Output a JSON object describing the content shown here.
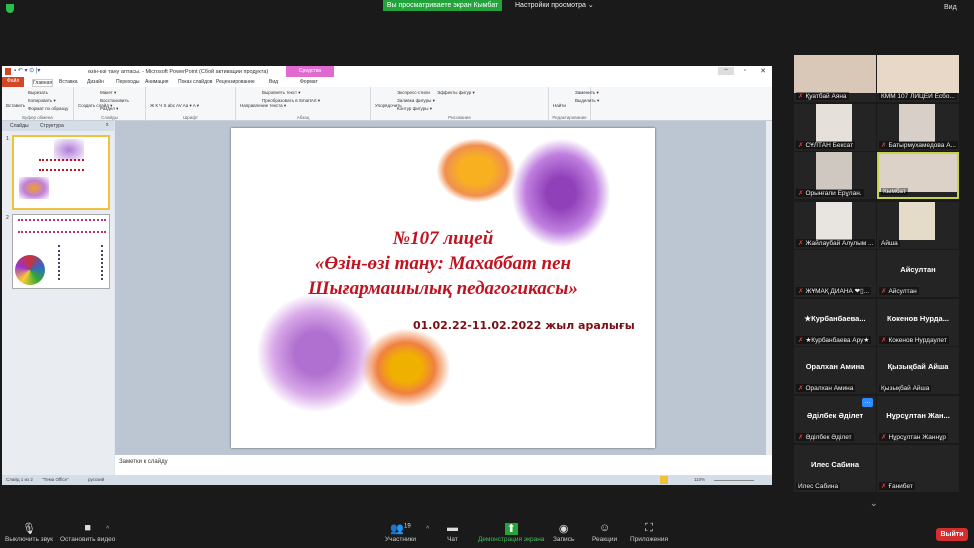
{
  "zoom": {
    "banner": "Вы просматриваете экран Кымбат",
    "view_options": "Настройки просмотра ⌄",
    "view": "Вид",
    "leave": "Выйти",
    "toolbar": [
      {
        "icon": "microphone-icon",
        "label": "Выключить звук"
      },
      {
        "icon": "video-camera-icon",
        "label": "Остановить видео"
      },
      {
        "icon": "participants-icon",
        "label": "Участники",
        "count": "19"
      },
      {
        "icon": "chat-icon",
        "label": "Чат"
      },
      {
        "icon": "share-screen-icon",
        "label": "Демонстрация экрана"
      },
      {
        "icon": "record-icon",
        "label": "Запись"
      },
      {
        "icon": "reactions-icon",
        "label": "Реакции"
      },
      {
        "icon": "apps-icon",
        "label": "Приложения"
      }
    ],
    "participants": [
      {
        "name": "Қуатбай Аяна",
        "muted": true,
        "video": true
      },
      {
        "name": "КММ 107 ЛИЦЕЙ Есбо...",
        "muted": false,
        "video": true
      },
      {
        "name": "СҰЛТАН Бексат",
        "muted": true,
        "video": true
      },
      {
        "name": "Батырмухамедова А...",
        "muted": true,
        "video": true
      },
      {
        "name": "Орынғали Ерұлан.",
        "muted": true,
        "video": true
      },
      {
        "name": "Кымбат",
        "muted": false,
        "video": true,
        "active": true
      },
      {
        "name": "Жайлаубай Алулым ...",
        "muted": true,
        "video": true
      },
      {
        "name": "Айша",
        "muted": false,
        "video": true
      },
      {
        "name": "ЖҰМАҚ ДИАНА ❤▯...",
        "muted": true,
        "video": false,
        "display": ""
      },
      {
        "name": "Айсултан",
        "muted": true,
        "video": false,
        "display": "Айсултан"
      },
      {
        "name": "★Курбанбаева Ару★",
        "muted": true,
        "video": false,
        "display": "★Курбанбаева..."
      },
      {
        "name": "Кокенов Нурдаулет",
        "muted": true,
        "video": false,
        "display": "Кокенов  Нурда..."
      },
      {
        "name": "Оралхан Амина",
        "muted": true,
        "video": false,
        "display": "Оралхан Амина"
      },
      {
        "name": "Қызықбай Айша",
        "muted": false,
        "video": false,
        "display": "Қызықбай Айша"
      },
      {
        "name": "Әділбек Әділет",
        "muted": true,
        "video": false,
        "display": "Әділбек Әділет"
      },
      {
        "name": "Нұрсұлтан Жаннұр",
        "muted": true,
        "video": false,
        "display": "Нұрсұлтан  Жан..."
      },
      {
        "name": "Илес Сабина",
        "muted": false,
        "video": false,
        "display": "Илес Сабина"
      },
      {
        "name": "Ғанибет",
        "muted": true,
        "video": false,
        "display": ""
      }
    ]
  },
  "ppt": {
    "window_title": "өзін-өзі тану аптасы.  -  Microsoft PowerPoint (Сбой активации продукта)",
    "context_tab": "Средства рисования",
    "tabs": [
      "Файл",
      "Главная",
      "Вставка",
      "Дизайн",
      "Переходы",
      "Анимация",
      "Показ слайдов",
      "Рецензирование",
      "Вид",
      "Формат"
    ],
    "groups": [
      {
        "label": "Буфер обмена",
        "items": [
          "Вставить",
          "Вырезать",
          "Копировать ▾",
          "Формат по образцу"
        ]
      },
      {
        "label": "Слайды",
        "items": [
          "Создать слайд ▾",
          "Макет ▾",
          "Восстановить",
          "Раздел ▾"
        ]
      },
      {
        "label": "Шрифт",
        "items": [
          "Ж К Ч S abc AV Aa ▾ A ▾"
        ]
      },
      {
        "label": "Абзац",
        "items": [
          "Направление текста ▾",
          "Выровнять текст ▾",
          "Преобразовать в SmartArt ▾"
        ]
      },
      {
        "label": "Рисование",
        "items": [
          "Упорядочить",
          "Экспресс-стили",
          "Заливка фигуры ▾",
          "Контур фигуры ▾",
          "Эффекты фигур ▾"
        ]
      },
      {
        "label": "Редактирование",
        "items": [
          "Найти",
          "Заменить ▾",
          "Выделить ▾"
        ]
      }
    ],
    "pane_tabs": [
      "Слайды",
      "Структура"
    ],
    "slide": {
      "line1": "№107 лицей",
      "line2": "«Өзін-өзі тану: Махаббат пен",
      "line3": "Шығармашылық педагогикасы»",
      "dates": "01.02.22-11.02.2022  жыл аралығы"
    },
    "notes_placeholder": "Заметки к слайду",
    "status": {
      "slide": "Слайд 1 из 2",
      "theme": "\"Тема Office\"",
      "language": "русский",
      "zoom": "110%"
    }
  }
}
